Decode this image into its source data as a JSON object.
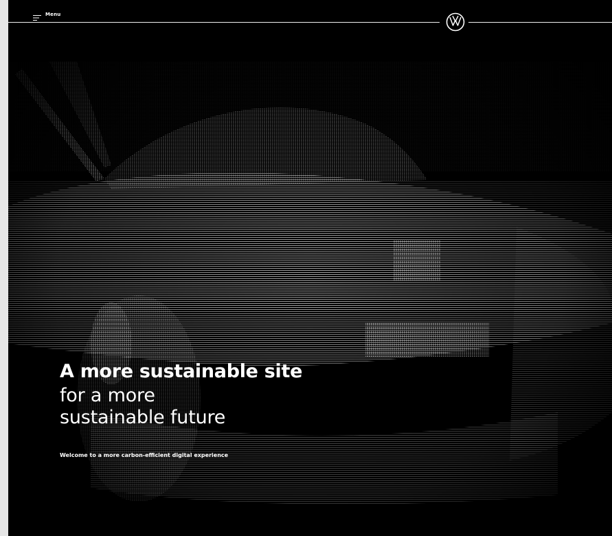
{
  "header": {
    "menu_label": "Menu",
    "menu_icon": "hamburger-menu-icon",
    "logo_icon": "vw-logo-icon"
  },
  "hero": {
    "headline_bold": "A more sustainable site",
    "headline_line2": "for a more",
    "headline_line3": "sustainable future",
    "subline": "Welcome to a more carbon-efficient digital experience"
  },
  "colors": {
    "background": "#000000",
    "text": "#ffffff",
    "gutter": "#e6e6e6"
  }
}
